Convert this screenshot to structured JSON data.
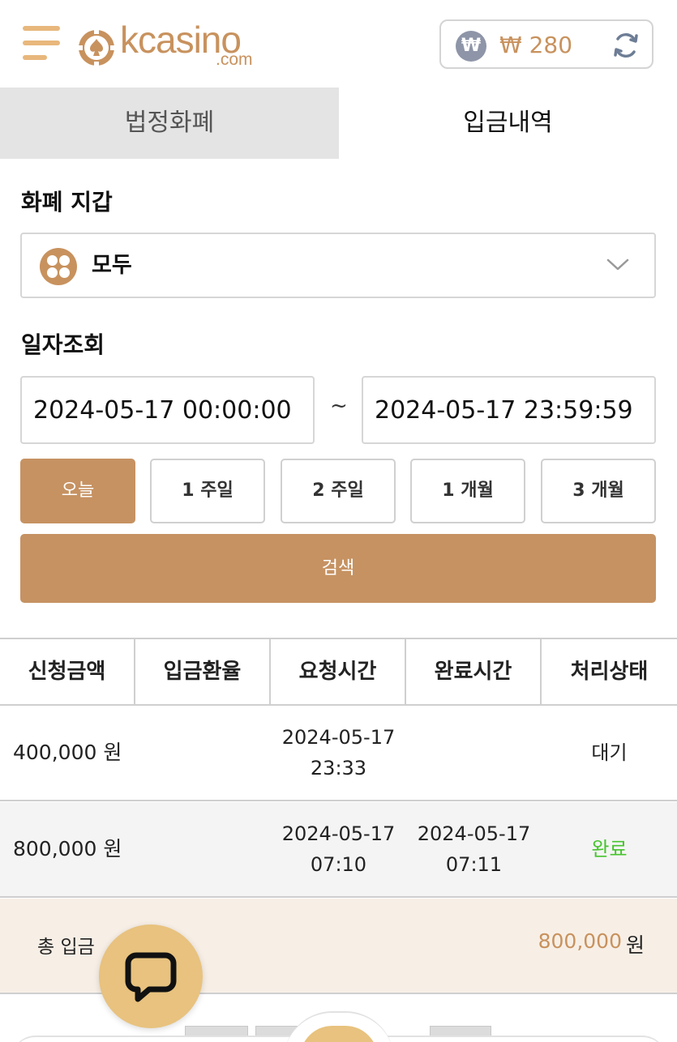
{
  "header": {
    "logo_text": "kcasino",
    "logo_sub": ".com",
    "balance": "₩ 280",
    "currency_symbol": "₩"
  },
  "tabs": [
    {
      "label": "법정화폐",
      "active": false
    },
    {
      "label": "입금내역",
      "active": true
    }
  ],
  "wallet": {
    "label": "화폐 지갑",
    "selected": "모두"
  },
  "date_query": {
    "label": "일자조회",
    "start": "2024-05-17 00:00:00",
    "end": "2024-05-17 23:59:59",
    "separator": "~"
  },
  "ranges": [
    "오늘",
    "1 주일",
    "2 주일",
    "1 개월",
    "3 개월"
  ],
  "active_range": "오늘",
  "search_label": "검색",
  "table": {
    "headers": [
      "신청금액",
      "입금환율",
      "요청시간",
      "완료시간",
      "처리상태"
    ],
    "rows": [
      {
        "amount": "400,000 원",
        "rate": "",
        "request_date": "2024-05-17",
        "request_time": "23:33",
        "complete_date": "",
        "complete_time": "",
        "status": "대기"
      },
      {
        "amount": "800,000 원",
        "rate": "",
        "request_date": "2024-05-17",
        "request_time": "07:10",
        "complete_date": "2024-05-17",
        "complete_time": "07:11",
        "status": "완료"
      }
    ]
  },
  "total": {
    "label": "총 입금",
    "amount": "800,000",
    "unit": "원"
  },
  "colors": {
    "accent": "#c69262",
    "done": "#45c42c",
    "chat": "#e8c27e"
  }
}
